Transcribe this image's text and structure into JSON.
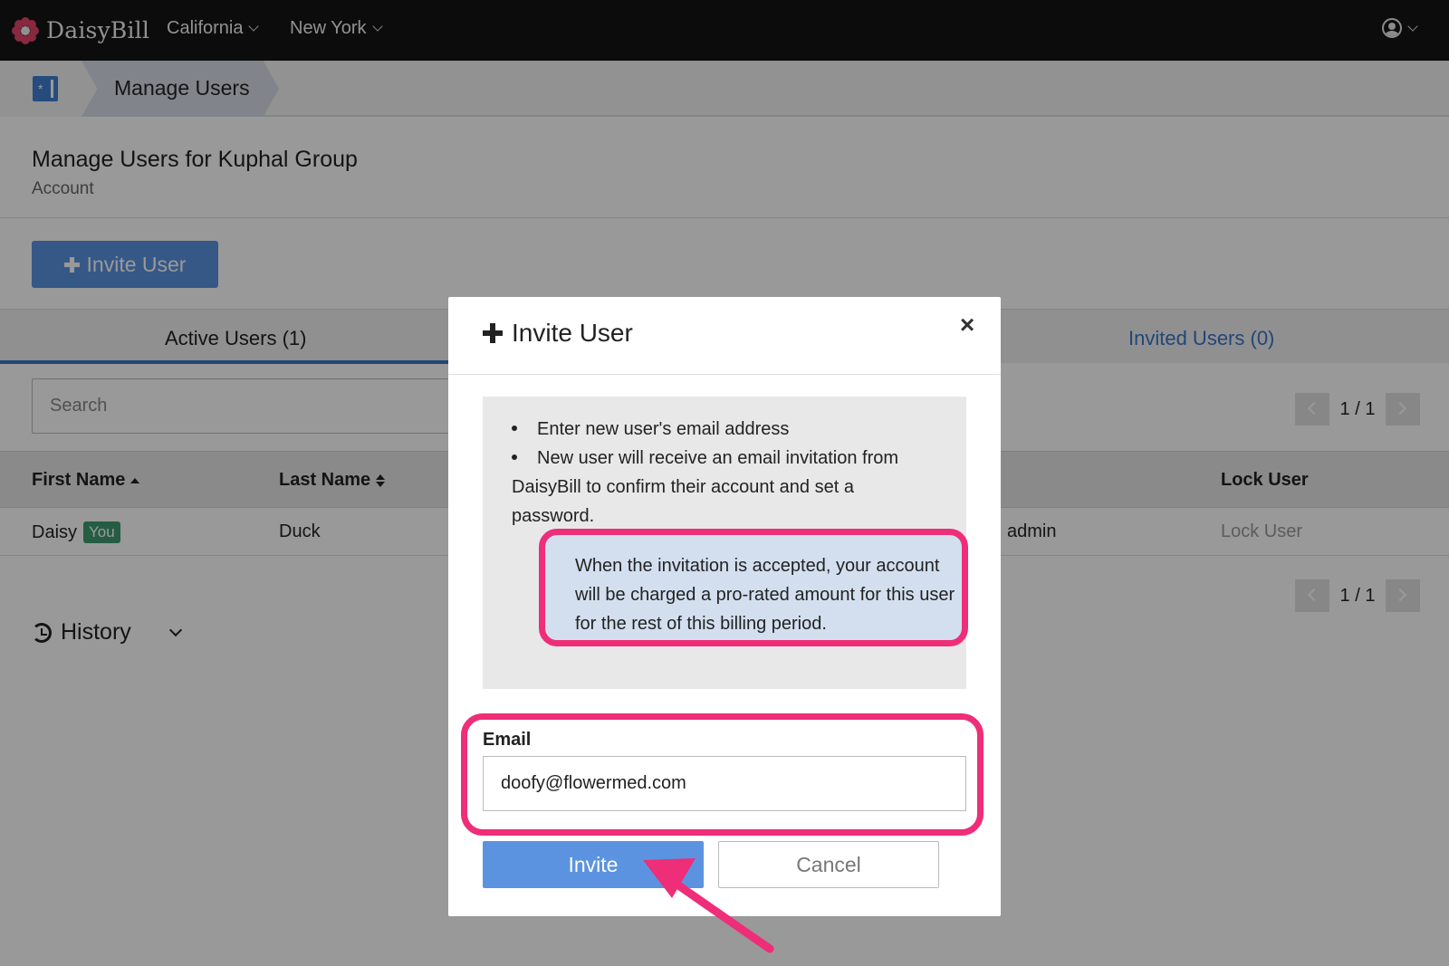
{
  "app": {
    "name": "DaisyBill"
  },
  "topnav": {
    "items": [
      {
        "label": "California"
      },
      {
        "label": "New York"
      }
    ]
  },
  "breadcrumb": {
    "current": "Manage Users"
  },
  "header": {
    "title": "Manage Users for Kuphal Group",
    "subtitle": "Account"
  },
  "invite_button": {
    "label": "Invite User"
  },
  "tabs": [
    {
      "label": "Active Users (1)"
    },
    {
      "label": "Invited Users (0)"
    }
  ],
  "search": {
    "placeholder": "Search"
  },
  "pager": {
    "text": "1 / 1"
  },
  "table": {
    "columns": [
      "First Name",
      "Last Name",
      "Lock User"
    ],
    "rows": [
      {
        "first": "Daisy",
        "badge": "You",
        "last": "Duck",
        "role": "admin",
        "lock": "Lock User"
      }
    ]
  },
  "history": {
    "label": "History"
  },
  "modal": {
    "title": "Invite User",
    "close": "×",
    "bullets": [
      "Enter new user's email address",
      "New user will receive an email invitation from",
      "DaisyBill to confirm their account and set a",
      "password."
    ],
    "note": "When the invitation is accepted, your account will be charged a pro-rated amount for this user for the rest of this billing period.",
    "email_label": "Email",
    "email_value": "doofy@flowermed.com",
    "invite": "Invite",
    "cancel": "Cancel"
  },
  "colors": {
    "accent": "#5b93e1",
    "highlight": "#ee2e78",
    "badge": "#3f9b72",
    "nav_bg": "#141414"
  }
}
